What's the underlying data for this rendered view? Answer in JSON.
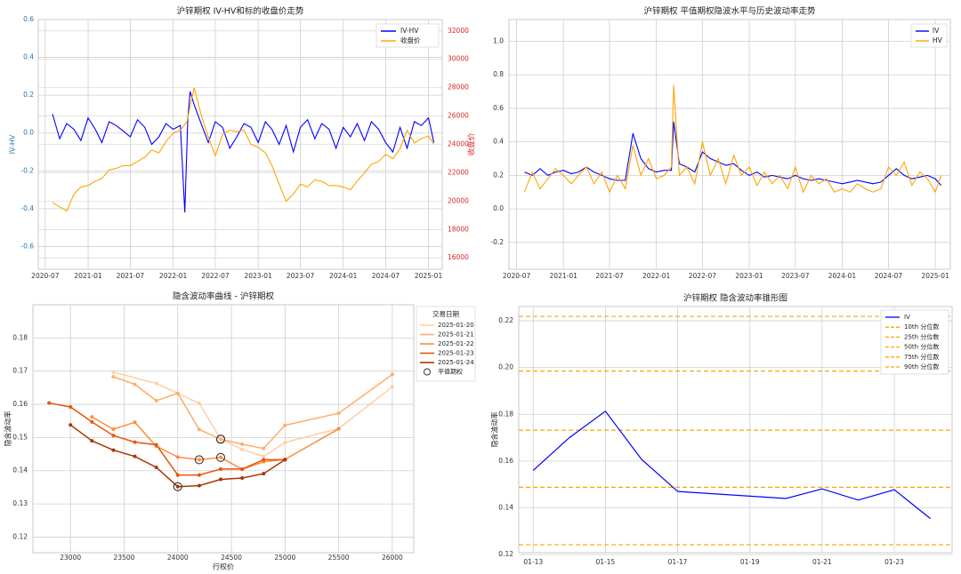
{
  "chart_data": [
    {
      "type": "line",
      "title": "沪锌期权 IV-HV和标的收盘价走势",
      "xlabel": "",
      "ylabel": "IV-HV",
      "y2label": "收盘价",
      "x_ticks": [
        "2020-07",
        "2021-01",
        "2021-07",
        "2022-01",
        "2022-07",
        "2023-01",
        "2023-07",
        "2024-01",
        "2024-07",
        "2025-01"
      ],
      "y_ticks": [
        "0.6",
        "0.4",
        "0.2",
        "0.0",
        "-0.2",
        "-0.4",
        "-0.6"
      ],
      "y2_ticks": [
        "32000",
        "30000",
        "28000",
        "26000",
        "24000",
        "22000",
        "20000",
        "18000",
        "16000"
      ],
      "ylim": [
        -0.72,
        0.6
      ],
      "y2lim": [
        15200,
        32800
      ],
      "xlim": [
        "2020-06-01",
        "2025-03-01"
      ],
      "grid": true,
      "legend": "top-right",
      "series": [
        {
          "name": "IV-HV",
          "color": "#0000ff",
          "axis": "left",
          "x": [
            "2020-08-01",
            "2020-09-01",
            "2020-10-01",
            "2020-11-01",
            "2020-12-01",
            "2021-01-01",
            "2021-02-01",
            "2021-03-01",
            "2021-04-01",
            "2021-05-01",
            "2021-06-01",
            "2021-07-01",
            "2021-08-01",
            "2021-09-01",
            "2021-10-01",
            "2021-11-01",
            "2021-12-01",
            "2022-01-01",
            "2022-02-01",
            "2022-02-20",
            "2022-03-05",
            "2022-03-15",
            "2022-04-01",
            "2022-05-01",
            "2022-06-01",
            "2022-07-01",
            "2022-08-01",
            "2022-09-01",
            "2022-10-01",
            "2022-11-01",
            "2022-12-01",
            "2023-01-01",
            "2023-02-01",
            "2023-03-01",
            "2023-04-01",
            "2023-05-01",
            "2023-06-01",
            "2023-07-01",
            "2023-08-01",
            "2023-09-01",
            "2023-10-01",
            "2023-11-01",
            "2023-12-01",
            "2024-01-01",
            "2024-02-01",
            "2024-03-01",
            "2024-04-01",
            "2024-05-01",
            "2024-06-01",
            "2024-07-01",
            "2024-08-01",
            "2024-09-01",
            "2024-10-01",
            "2024-11-01",
            "2024-12-01",
            "2025-01-01",
            "2025-01-24"
          ],
          "values": [
            0.1,
            -0.03,
            0.05,
            0.02,
            -0.04,
            0.08,
            0.02,
            -0.05,
            0.06,
            0.04,
            0.01,
            -0.02,
            0.07,
            0.03,
            -0.06,
            -0.02,
            0.05,
            0.02,
            0.04,
            -0.42,
            0.08,
            0.22,
            0.15,
            0.05,
            -0.05,
            0.06,
            0.03,
            -0.08,
            -0.02,
            0.05,
            0.03,
            -0.05,
            0.06,
            0.02,
            -0.06,
            0.04,
            -0.1,
            0.03,
            0.07,
            -0.03,
            0.05,
            0.02,
            -0.08,
            0.03,
            -0.02,
            0.05,
            -0.04,
            0.06,
            0.02,
            -0.05,
            -0.1,
            0.03,
            -0.08,
            0.06,
            0.04,
            0.08,
            -0.05
          ]
        },
        {
          "name": "收盘价",
          "color": "#ffa500",
          "axis": "right",
          "x": [
            "2020-08-01",
            "2020-09-01",
            "2020-10-01",
            "2020-11-01",
            "2020-12-01",
            "2021-01-01",
            "2021-02-01",
            "2021-03-01",
            "2021-04-01",
            "2021-05-01",
            "2021-06-01",
            "2021-07-01",
            "2021-08-01",
            "2021-09-01",
            "2021-10-01",
            "2021-11-01",
            "2021-12-01",
            "2022-01-01",
            "2022-02-01",
            "2022-03-01",
            "2022-04-01",
            "2022-05-01",
            "2022-06-01",
            "2022-07-01",
            "2022-08-01",
            "2022-09-01",
            "2022-10-01",
            "2022-11-01",
            "2022-12-01",
            "2023-01-01",
            "2023-02-01",
            "2023-03-01",
            "2023-04-01",
            "2023-05-01",
            "2023-06-01",
            "2023-07-01",
            "2023-08-01",
            "2023-09-01",
            "2023-10-01",
            "2023-11-01",
            "2023-12-01",
            "2024-01-01",
            "2024-02-01",
            "2024-03-01",
            "2024-04-01",
            "2024-05-01",
            "2024-06-01",
            "2024-07-01",
            "2024-08-01",
            "2024-09-01",
            "2024-10-01",
            "2024-11-01",
            "2024-12-01",
            "2025-01-01",
            "2025-01-24"
          ],
          "values": [
            19900,
            19600,
            19300,
            20500,
            21000,
            21100,
            21400,
            21600,
            22200,
            22300,
            22500,
            22500,
            22800,
            23100,
            23600,
            23400,
            24200,
            24800,
            25000,
            25600,
            28000,
            26100,
            24500,
            23200,
            24700,
            25000,
            24900,
            25000,
            24000,
            23800,
            23400,
            22500,
            21200,
            20000,
            20500,
            21200,
            21000,
            21500,
            21400,
            21100,
            21100,
            21000,
            20800,
            21400,
            22000,
            22600,
            22800,
            23300,
            23000,
            23700,
            25000,
            24100,
            24400,
            24600,
            24000
          ]
        }
      ]
    },
    {
      "type": "line",
      "title": "沪锌期权 平值期权隐波水平与历史波动率走势",
      "xlabel": "",
      "ylabel": "",
      "x_ticks": [
        "2020-07",
        "2021-01",
        "2021-07",
        "2022-01",
        "2022-07",
        "2023-01",
        "2023-07",
        "2024-01",
        "2024-07",
        "2025-01"
      ],
      "y_ticks": [
        "1.0",
        "0.8",
        "0.6",
        "0.4",
        "0.2",
        "0.0",
        "-0.2"
      ],
      "ylim": [
        -0.36,
        1.13
      ],
      "xlim": [
        "2020-06-01",
        "2025-03-01"
      ],
      "grid": true,
      "legend": "top-right",
      "series": [
        {
          "name": "IV",
          "color": "#0000ff",
          "x": [
            "2020-08-01",
            "2020-09-01",
            "2020-10-01",
            "2020-11-01",
            "2020-12-01",
            "2021-01-01",
            "2021-02-01",
            "2021-03-01",
            "2021-04-01",
            "2021-05-01",
            "2021-06-01",
            "2021-07-01",
            "2021-08-01",
            "2021-09-01",
            "2021-10-01",
            "2021-11-01",
            "2021-12-01",
            "2022-01-01",
            "2022-02-01",
            "2022-03-01",
            "2022-03-10",
            "2022-04-01",
            "2022-05-01",
            "2022-06-01",
            "2022-07-01",
            "2022-08-01",
            "2022-09-01",
            "2022-10-01",
            "2022-11-01",
            "2022-12-01",
            "2023-01-01",
            "2023-02-01",
            "2023-03-01",
            "2023-04-01",
            "2023-05-01",
            "2023-06-01",
            "2023-07-01",
            "2023-08-01",
            "2023-09-01",
            "2023-10-01",
            "2023-11-01",
            "2023-12-01",
            "2024-01-01",
            "2024-02-01",
            "2024-03-01",
            "2024-04-01",
            "2024-05-01",
            "2024-06-01",
            "2024-07-01",
            "2024-08-01",
            "2024-09-01",
            "2024-10-01",
            "2024-11-01",
            "2024-12-01",
            "2025-01-01",
            "2025-01-24"
          ],
          "values": [
            0.22,
            0.2,
            0.24,
            0.2,
            0.22,
            0.23,
            0.21,
            0.22,
            0.25,
            0.22,
            0.2,
            0.18,
            0.17,
            0.17,
            0.45,
            0.3,
            0.24,
            0.22,
            0.23,
            0.23,
            0.52,
            0.27,
            0.25,
            0.22,
            0.34,
            0.3,
            0.28,
            0.26,
            0.27,
            0.23,
            0.2,
            0.22,
            0.19,
            0.2,
            0.19,
            0.18,
            0.2,
            0.18,
            0.17,
            0.18,
            0.17,
            0.16,
            0.15,
            0.16,
            0.17,
            0.16,
            0.15,
            0.16,
            0.2,
            0.24,
            0.2,
            0.18,
            0.19,
            0.2,
            0.18,
            0.14
          ]
        },
        {
          "name": "HV",
          "color": "#ffa500",
          "x": [
            "2020-08-01",
            "2020-09-01",
            "2020-10-01",
            "2020-11-01",
            "2020-12-01",
            "2021-01-01",
            "2021-02-01",
            "2021-03-01",
            "2021-04-01",
            "2021-05-01",
            "2021-06-01",
            "2021-07-01",
            "2021-08-01",
            "2021-09-01",
            "2021-10-01",
            "2021-11-01",
            "2021-12-01",
            "2022-01-01",
            "2022-02-01",
            "2022-03-01",
            "2022-03-10",
            "2022-04-01",
            "2022-05-01",
            "2022-06-01",
            "2022-07-01",
            "2022-08-01",
            "2022-09-01",
            "2022-10-01",
            "2022-11-01",
            "2022-12-01",
            "2023-01-01",
            "2023-02-01",
            "2023-03-01",
            "2023-04-01",
            "2023-05-01",
            "2023-06-01",
            "2023-07-01",
            "2023-08-01",
            "2023-09-01",
            "2023-10-01",
            "2023-11-01",
            "2023-12-01",
            "2024-01-01",
            "2024-02-01",
            "2024-03-01",
            "2024-04-01",
            "2024-05-01",
            "2024-06-01",
            "2024-07-01",
            "2024-08-01",
            "2024-09-01",
            "2024-10-01",
            "2024-11-01",
            "2024-12-01",
            "2025-01-01",
            "2025-01-24"
          ],
          "values": [
            0.1,
            0.22,
            0.12,
            0.18,
            0.24,
            0.2,
            0.15,
            0.2,
            0.25,
            0.15,
            0.22,
            0.1,
            0.2,
            0.12,
            0.38,
            0.2,
            0.3,
            0.18,
            0.2,
            0.25,
            0.74,
            0.2,
            0.25,
            0.15,
            0.4,
            0.2,
            0.3,
            0.15,
            0.32,
            0.2,
            0.25,
            0.14,
            0.22,
            0.15,
            0.2,
            0.12,
            0.25,
            0.1,
            0.2,
            0.15,
            0.18,
            0.1,
            0.12,
            0.1,
            0.15,
            0.12,
            0.1,
            0.12,
            0.25,
            0.2,
            0.28,
            0.14,
            0.22,
            0.18,
            0.1,
            0.2
          ]
        }
      ]
    },
    {
      "type": "line",
      "title": "隐含波动率曲线 - 沪锌期权",
      "xlabel": "行权价",
      "ylabel": "隐含波动率",
      "x_ticks": [
        "23000",
        "23500",
        "24000",
        "24500",
        "25000",
        "25500",
        "26000"
      ],
      "y_ticks": [
        "0.18",
        "0.17",
        "0.16",
        "0.15",
        "0.14",
        "0.13",
        "0.12"
      ],
      "xlim": [
        22650,
        26200
      ],
      "ylim": [
        0.1153,
        0.19
      ],
      "grid": true,
      "legend_title": "交易日期",
      "legend": "top-right",
      "atm_label": "平值期权",
      "series": [
        {
          "name": "2025-01-20",
          "color": "#fdd0a2",
          "x": [
            23400,
            23800,
            24000,
            24200,
            24400,
            24600,
            24800,
            25000,
            25500,
            26000
          ],
          "values": [
            0.1697,
            0.1663,
            0.1633,
            0.1603,
            0.1495,
            0.1464,
            0.1443,
            0.1485,
            0.1527,
            0.1653
          ],
          "atm": [
            24400,
            0.1495
          ]
        },
        {
          "name": "2025-01-21",
          "color": "#fdae6b",
          "x": [
            23400,
            23600,
            23800,
            24000,
            24200,
            24400,
            24600,
            24800,
            25000,
            25500,
            26000
          ],
          "values": [
            0.1683,
            0.166,
            0.1611,
            0.1633,
            0.1524,
            0.1495,
            0.148,
            0.1467,
            0.1537,
            0.1573,
            0.169
          ],
          "atm": [
            24400,
            0.1495
          ]
        },
        {
          "name": "2025-01-22",
          "color": "#fd8d3c",
          "x": [
            23200,
            23400,
            23600,
            23800,
            24000,
            24200,
            24400,
            24600,
            24800,
            25000,
            25500
          ],
          "values": [
            0.1562,
            0.1525,
            0.1546,
            0.1474,
            0.1441,
            0.1433,
            0.144,
            0.1404,
            0.1427,
            0.1434,
            0.1526
          ],
          "atm": [
            24400,
            0.144
          ]
        },
        {
          "name": "2025-01-23",
          "color": "#e6550d",
          "x": [
            22800,
            23000,
            23200,
            23400,
            23600,
            23800,
            24000,
            24200,
            24400,
            24600,
            24800,
            25000
          ],
          "values": [
            0.1604,
            0.1592,
            0.1547,
            0.1506,
            0.1486,
            0.1478,
            0.1387,
            0.1387,
            0.1405,
            0.1405,
            0.1433,
            0.1433
          ],
          "atm": [
            24200,
            0.1433
          ]
        },
        {
          "name": "2025-01-24",
          "color": "#a63603",
          "x": [
            23000,
            23200,
            23400,
            23600,
            23800,
            24000,
            24200,
            24400,
            24600,
            24800,
            25000
          ],
          "values": [
            0.1538,
            0.149,
            0.1462,
            0.1443,
            0.141,
            0.1352,
            0.1355,
            0.1374,
            0.1378,
            0.1391,
            0.1433
          ],
          "atm": [
            24000,
            0.1352
          ]
        }
      ]
    },
    {
      "type": "line",
      "title": "沪锌期权 隐含波动率锥形图",
      "xlabel": "",
      "ylabel": "隐含波动率",
      "x_ticks": [
        "01-13",
        "01-15",
        "01-17",
        "01-19",
        "01-21",
        "01-23"
      ],
      "y_ticks": [
        "0.22",
        "0.20",
        "0.18",
        "0.16",
        "0.14",
        "0.12"
      ],
      "ylim": [
        0.1208,
        0.2261
      ],
      "xlim": [
        "2025-01-12.6",
        "2025-01-24.6"
      ],
      "grid": true,
      "legend": "top-right",
      "series": [
        {
          "name": "IV",
          "color": "#0000ff",
          "x": [
            "2025-01-13",
            "2025-01-14",
            "2025-01-15",
            "2025-01-16",
            "2025-01-17",
            "2025-01-20",
            "2025-01-21",
            "2025-01-22",
            "2025-01-23",
            "2025-01-24"
          ],
          "values": [
            0.156,
            0.17,
            0.1813,
            0.1607,
            0.147,
            0.144,
            0.1481,
            0.1433,
            0.1477,
            0.1354
          ]
        }
      ],
      "percentiles": [
        {
          "name": "10th 分位数",
          "value": 0.1242
        },
        {
          "name": "25th 分位数",
          "value": 0.1488
        },
        {
          "name": "50th 分位数",
          "value": 0.1732
        },
        {
          "name": "75th 分位数",
          "value": 0.1985
        },
        {
          "name": "90th 分位数",
          "value": 0.2219
        }
      ],
      "percentile_color": "#ffa500"
    }
  ]
}
